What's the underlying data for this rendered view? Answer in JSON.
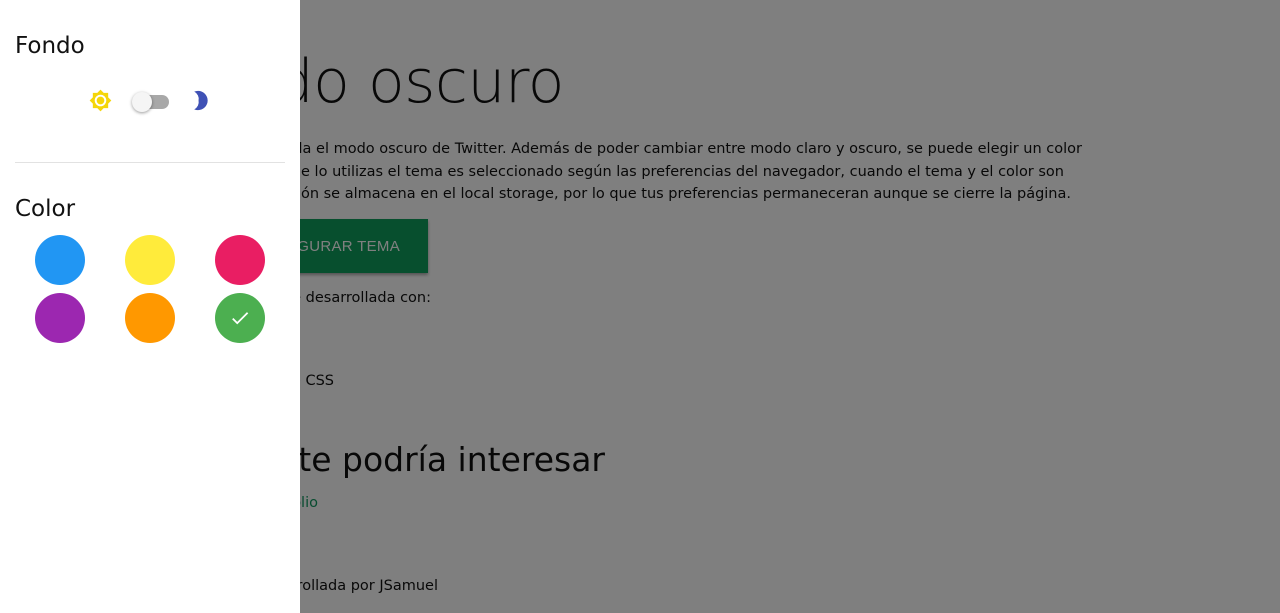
{
  "page": {
    "title": "do oscuro",
    "description_lines": [
      "que simula el modo oscuro de Twitter. Además de poder cambiar entre modo claro y oscuro, se puede elegir un color",
      "nera vez que lo utilizas el tema es seleccionado según las preferencias del navegador, cuando el tema y el color son",
      "ta información se almacena en el local storage, por lo que tus preferencias permaneceran aunque se cierre la página."
    ],
    "config_button_label": "IGURAR TEMA",
    "tech_intro": "ue desarrollada con:",
    "tech_item": "e CSS",
    "interest_title": "n te podría interesar",
    "portfolio_link": "olio",
    "footer": "arrollada por JSamuel"
  },
  "drawer": {
    "background_heading": "Fondo",
    "color_heading": "Color",
    "dark_mode_enabled": false,
    "swatches": [
      {
        "name": "blue",
        "color": "#2196f3",
        "selected": false
      },
      {
        "name": "yellow",
        "color": "#ffeb3b",
        "selected": false
      },
      {
        "name": "pink",
        "color": "#e91e63",
        "selected": false
      },
      {
        "name": "purple",
        "color": "#9c27b0",
        "selected": false
      },
      {
        "name": "orange",
        "color": "#ff9800",
        "selected": false
      },
      {
        "name": "green",
        "color": "#4caf50",
        "selected": true
      }
    ]
  },
  "icons": {
    "sun": "sun-icon",
    "moon": "moon-icon",
    "check": "check-icon"
  },
  "colors": {
    "accent": "#4caf50",
    "button": "#0e9e5c",
    "link": "#119961",
    "sun": "#f5d60a",
    "moon": "#3f51b5",
    "overlay": "rgba(0,0,0,0.5)"
  }
}
